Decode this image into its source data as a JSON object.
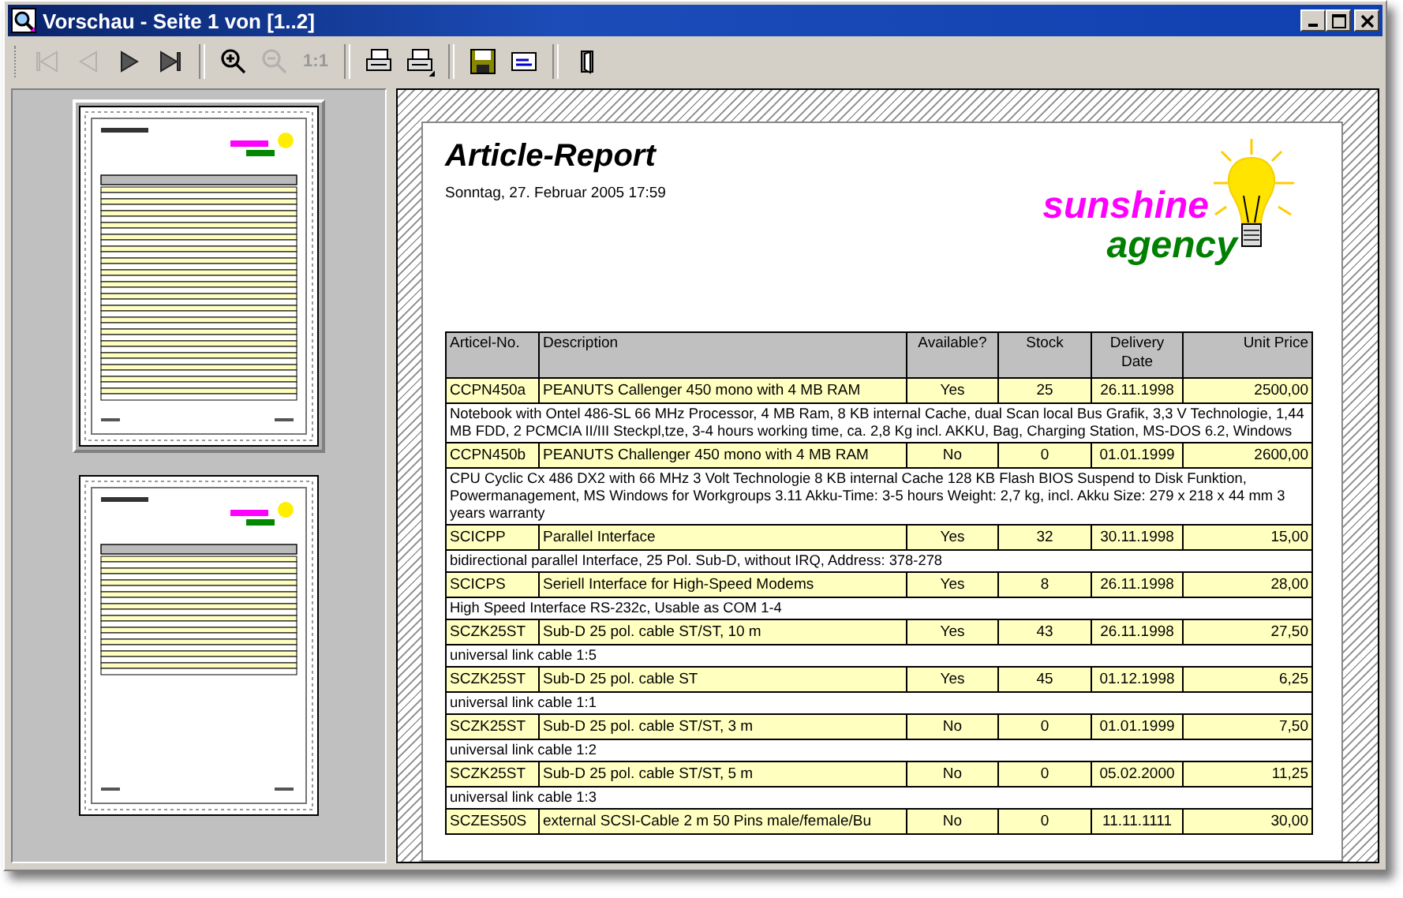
{
  "window": {
    "title": "Vorschau - Seite 1 von [1..2]"
  },
  "toolbar": [
    {
      "kind": "first",
      "disabled": true
    },
    {
      "kind": "prev",
      "disabled": true
    },
    {
      "kind": "next",
      "disabled": false
    },
    {
      "kind": "last",
      "disabled": false
    },
    {
      "kind": "separator"
    },
    {
      "kind": "zoom-in",
      "disabled": false
    },
    {
      "kind": "zoom-out",
      "disabled": true
    },
    {
      "kind": "actual-size",
      "label": "1:1",
      "disabled": true
    },
    {
      "kind": "separator"
    },
    {
      "kind": "print",
      "disabled": false
    },
    {
      "kind": "print-setup",
      "disabled": false
    },
    {
      "kind": "separator"
    },
    {
      "kind": "save",
      "disabled": false
    },
    {
      "kind": "email",
      "disabled": false
    },
    {
      "kind": "separator"
    },
    {
      "kind": "exit",
      "disabled": false
    }
  ],
  "pages": [
    {
      "selected": true
    },
    {
      "selected": false
    }
  ],
  "report": {
    "title": "Article-Report",
    "date": "Sonntag, 27. Februar 2005 17:59",
    "logo": {
      "line_1": "sunshine",
      "line_2": "agency"
    },
    "columns": [
      "Articel-No.",
      "Description",
      "Available?",
      "Stock",
      "Delivery Date",
      "Unit Price"
    ],
    "rows": [
      {
        "article_no": "CCPN450a",
        "description": "PEANUTS Callenger 450 mono with 4 MB RAM",
        "available": "Yes",
        "stock": "25",
        "delivery_date": "26.11.1998",
        "unit_price": "2500,00",
        "details": "Notebook with Ontel 486-SL 66 MHz Processor, 4 MB Ram, 8 KB internal Cache, dual Scan local Bus Grafik, 3,3 V Technologie, 1,44 MB FDD, 2 PCMCIA II/III Steckpl,tze, 3-4 hours working time, ca. 2,8 Kg incl. AKKU, Bag, Charging Station, MS-DOS 6.2, Windows"
      },
      {
        "article_no": "CCPN450b",
        "description": "PEANUTS Challenger 450 mono with 4 MB RAM",
        "available": "No",
        "stock": "0",
        "delivery_date": "01.01.1999",
        "unit_price": "2600,00",
        "details": "CPU Cyclic Cx 486 DX2 with 66 MHz 3 Volt Technologie 8 KB internal Cache 128 KB Flash BIOS Suspend to Disk Funktion, Powermanagement, MS Windows for Workgroups 3.11 Akku-Time: 3-5 hours Weight: 2,7 kg, incl. Akku Size: 279 x 218 x 44 mm 3 years warranty"
      },
      {
        "article_no": "SCICPP",
        "description": "Parallel Interface",
        "available": "Yes",
        "stock": "32",
        "delivery_date": "30.11.1998",
        "unit_price": "15,00",
        "details": "bidirectional parallel Interface, 25 Pol. Sub-D, without IRQ, Address: 378-278"
      },
      {
        "article_no": "SCICPS",
        "description": "Seriell Interface for High-Speed Modems",
        "available": "Yes",
        "stock": "8",
        "delivery_date": "26.11.1998",
        "unit_price": "28,00",
        "details": "High Speed Interface RS-232c, Usable as COM 1-4"
      },
      {
        "article_no": "SCZK25ST",
        "description": "Sub-D 25 pol. cable ST/ST, 10 m",
        "available": "Yes",
        "stock": "43",
        "delivery_date": "26.11.1998",
        "unit_price": "27,50",
        "details": "universal link cable 1:5"
      },
      {
        "article_no": "SCZK25ST",
        "description": "Sub-D 25 pol. cable ST",
        "available": "Yes",
        "stock": "45",
        "delivery_date": "01.12.1998",
        "unit_price": "6,25",
        "details": "universal link cable 1:1"
      },
      {
        "article_no": "SCZK25ST",
        "description": "Sub-D 25 pol. cable ST/ST, 3 m",
        "available": "No",
        "stock": "0",
        "delivery_date": "01.01.1999",
        "unit_price": "7,50",
        "details": "universal link cable 1:2"
      },
      {
        "article_no": "SCZK25ST",
        "description": "Sub-D 25 pol. cable ST/ST, 5 m",
        "available": "No",
        "stock": "0",
        "delivery_date": "05.02.2000",
        "unit_price": "11,25",
        "details": "universal link cable 1:3"
      },
      {
        "article_no": "SCZES50S",
        "description": "external SCSI-Cable 2 m 50 Pins male/female/Bu",
        "available": "No",
        "stock": "0",
        "delivery_date": "11.11.1111",
        "unit_price": "30,00"
      }
    ]
  }
}
